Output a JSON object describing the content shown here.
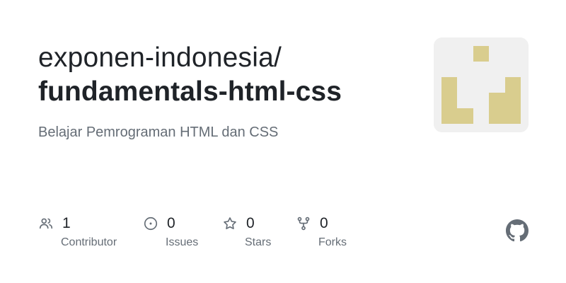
{
  "repo": {
    "owner": "exponen-indonesia/",
    "name": "fundamentals-html-css",
    "description": "Belajar Pemrograman HTML dan CSS"
  },
  "stats": [
    {
      "icon": "people-icon",
      "count": "1",
      "label": "Contributor"
    },
    {
      "icon": "issue-icon",
      "count": "0",
      "label": "Issues"
    },
    {
      "icon": "star-icon",
      "count": "0",
      "label": "Stars"
    },
    {
      "icon": "fork-icon",
      "count": "0",
      "label": "Forks"
    }
  ],
  "colors": {
    "text_primary": "#1f2328",
    "text_secondary": "#656d76",
    "avatar_bg": "#f0f0f0",
    "avatar_fg": "#d9cd8e",
    "icon": "#656d76"
  },
  "brand_icon": "github-mark-icon"
}
